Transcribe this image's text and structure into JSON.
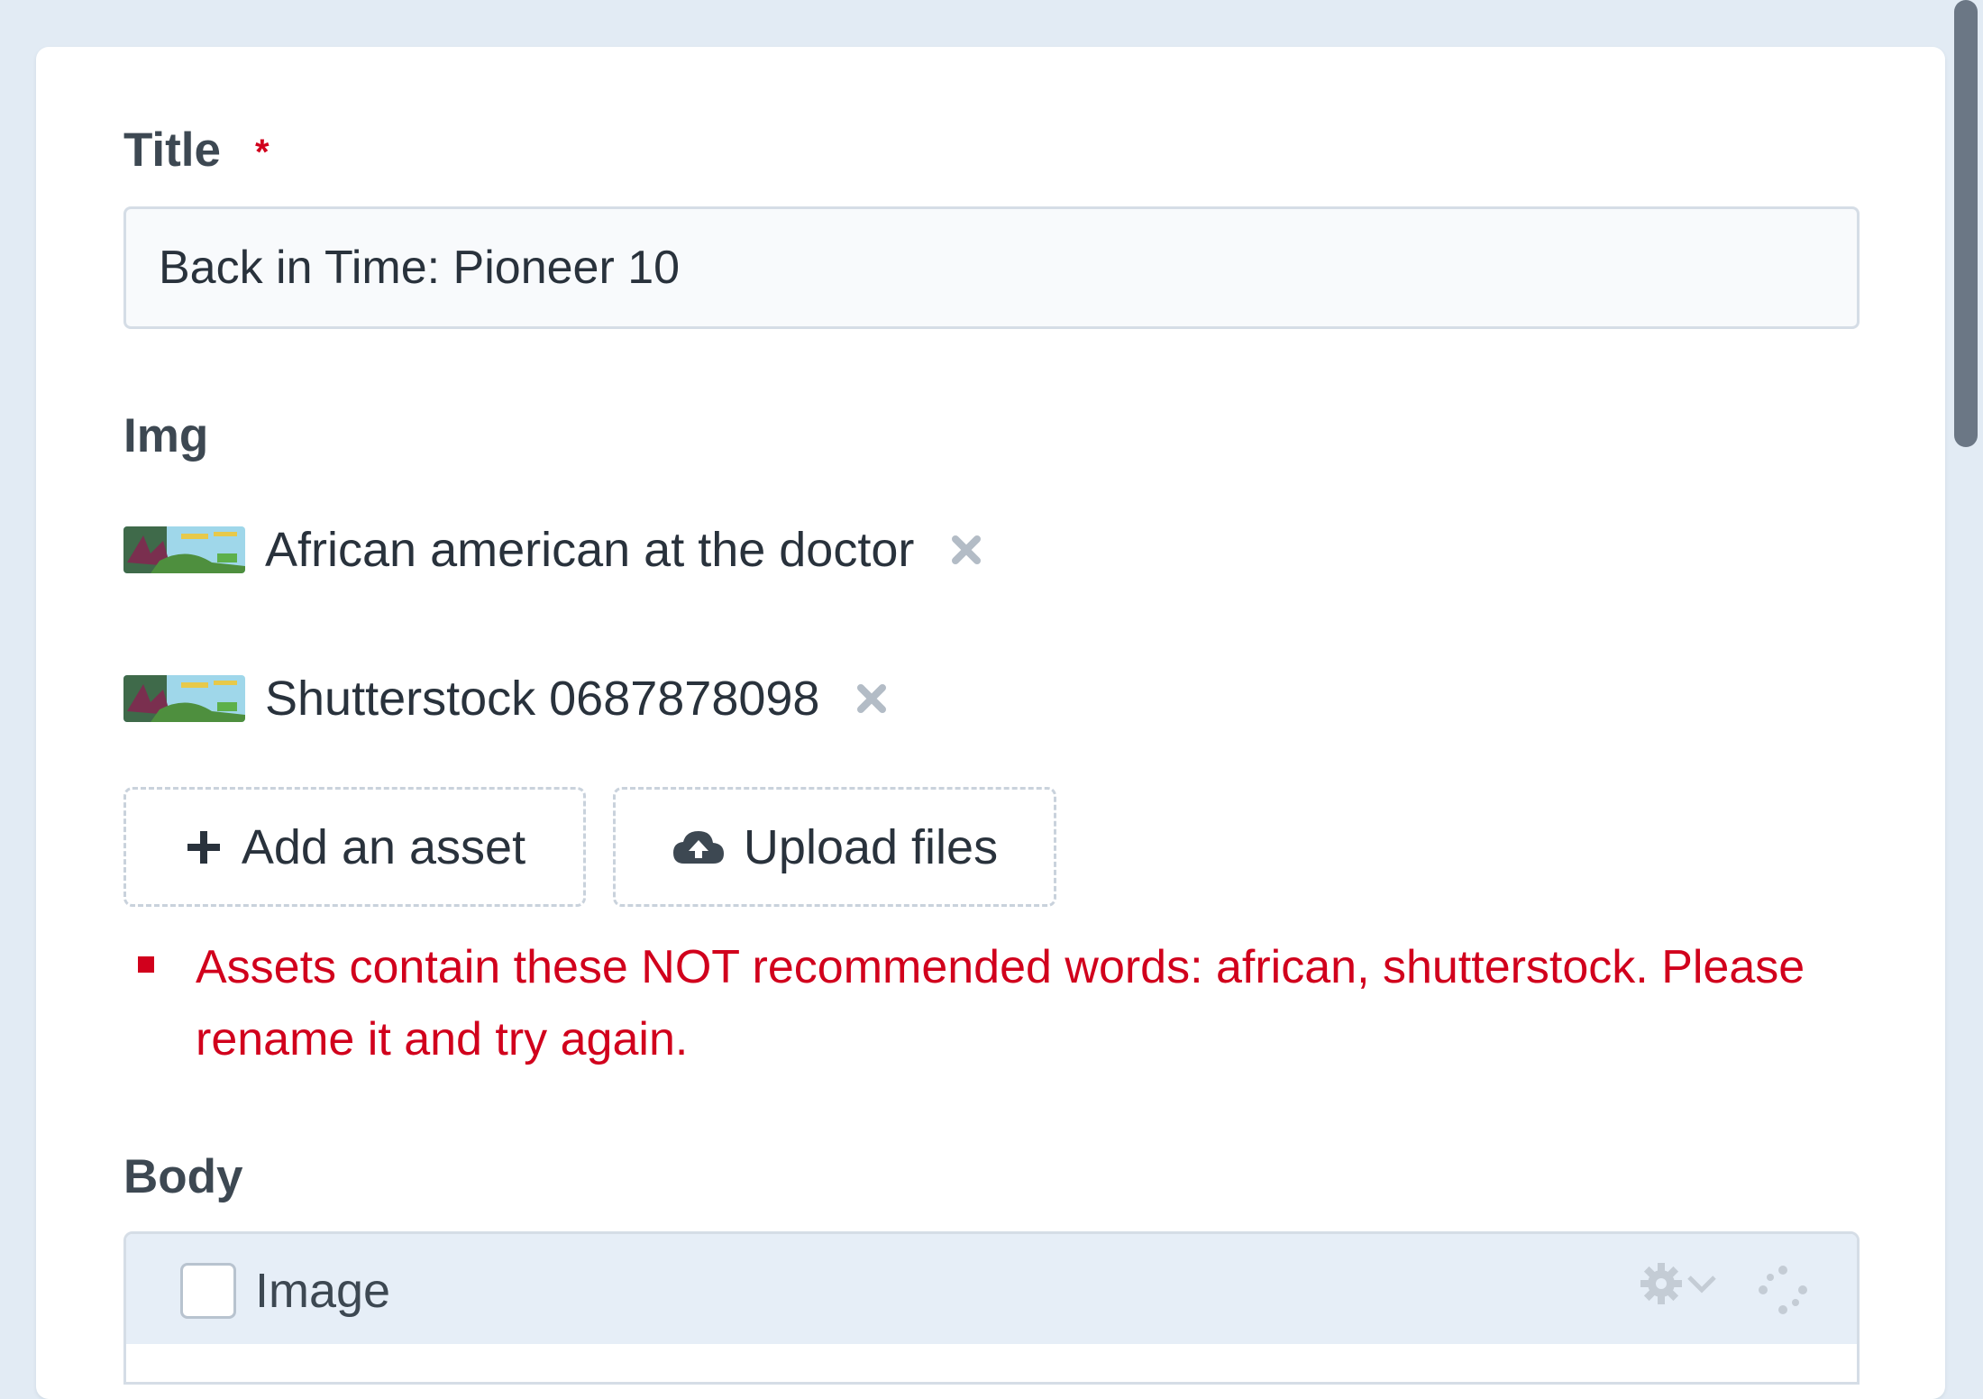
{
  "form": {
    "title_field": {
      "label": "Title",
      "required_marker": "*",
      "value": "Back in Time: Pioneer 10"
    },
    "img_field": {
      "label": "Img",
      "assets": [
        {
          "name": "African american at the doctor",
          "thumb_icon": "image-thumbnail-icon",
          "remove_icon": "close-icon"
        },
        {
          "name": "Shutterstock 0687878098",
          "thumb_icon": "image-thumbnail-icon",
          "remove_icon": "close-icon"
        }
      ],
      "add_asset_label": "Add an asset",
      "upload_files_label": "Upload files",
      "error_message": "Assets contain these NOT recommended words: african, shutterstock. Please rename it and try again."
    },
    "body_field": {
      "label": "Body",
      "block": {
        "label": "Image",
        "settings_icon": "gear-icon",
        "drag_icon": "drag-handle-icon"
      }
    }
  },
  "colors": {
    "page_background": "#e2ebf4",
    "error": "#d1001c",
    "text": "#29323c",
    "label": "#3d4852",
    "input_border": "#d5dde6"
  }
}
